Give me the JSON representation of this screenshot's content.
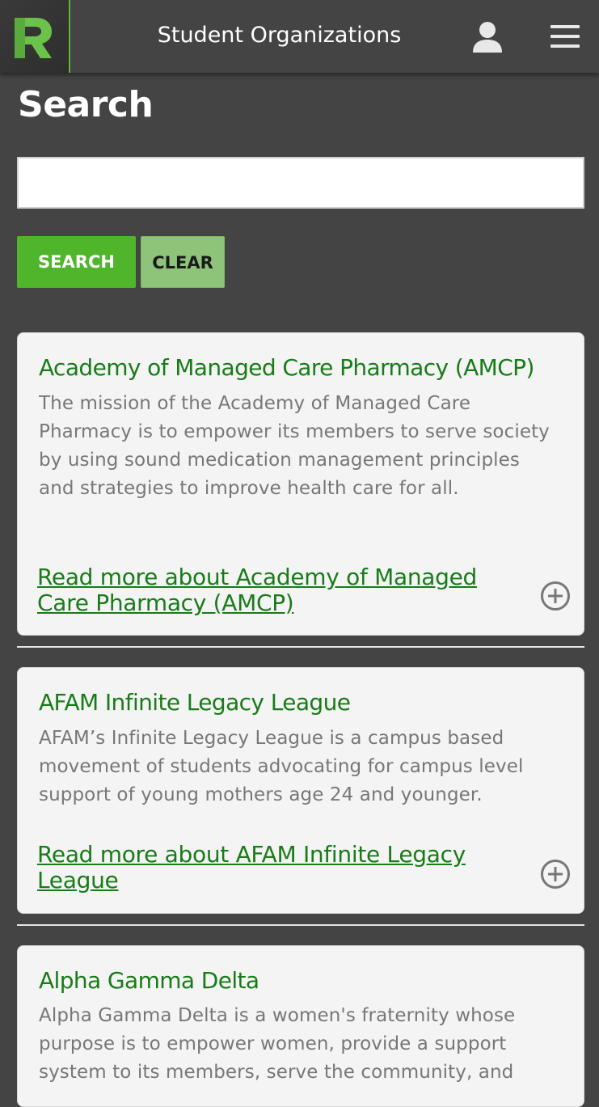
{
  "header": {
    "title": "Student Organizations",
    "logo_letter": "R",
    "user_icon": "user-icon",
    "menu_icon": "hamburger-menu-icon"
  },
  "search": {
    "heading": "Search",
    "input_value": "",
    "input_placeholder": "",
    "search_button_label": "Search",
    "clear_button_label": "Clear"
  },
  "colors": {
    "background": "#444444",
    "accent_green": "#4fb52b",
    "title_green": "#187c18",
    "clear_green": "#8ec479"
  },
  "organizations": [
    {
      "name": "Academy of Managed Care Pharmacy (AMCP)",
      "description": "The mission of the Academy of Managed Care Pharmacy is to empower its members to serve society by using sound medication management principles and strategies to improve health care for all.",
      "link_text": "Read more about Academy of Managed Care Pharmacy (AMCP)",
      "expand_icon": "plus-circle-icon"
    },
    {
      "name": "AFAM Infinite Legacy League",
      "description": "AFAM’s Infinite Legacy League is a campus based movement of students advocating for campus level support of young mothers age 24 and younger.",
      "link_text": "Read more about AFAM Infinite Legacy League",
      "expand_icon": "plus-circle-icon"
    },
    {
      "name": "Alpha Gamma Delta",
      "description": "Alpha Gamma Delta is a women's fraternity whose purpose is to empower women, provide a support system to its members, serve the community, and",
      "link_text": "",
      "expand_icon": ""
    }
  ]
}
